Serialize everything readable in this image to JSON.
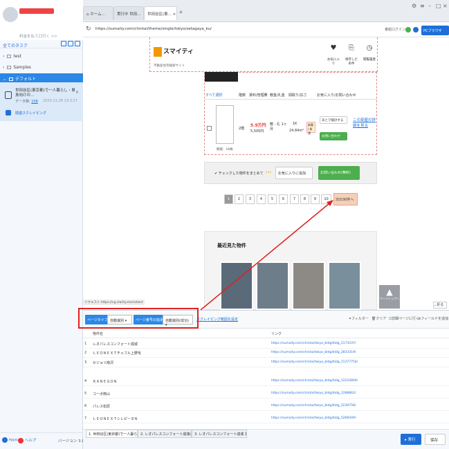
{
  "sidebar": {
    "upgrade_link": "料金を払う口行く >>",
    "tasks_title": "全てのタスク",
    "tree": [
      "test",
      "Samples"
    ],
    "default_folder": "デフォルト",
    "task": {
      "title": "世田谷区(東京都)で一人暮らし・単身向けの...",
      "meta_label": "データ数:",
      "meta_value": "108",
      "date": "2023-11-28 13:3:17",
      "sub": "関連スクレイピング"
    },
    "home": "Home",
    "help": "ヘルプ",
    "version": "バージョン 3.8.4"
  },
  "browser": {
    "tabs": [
      "ホーム...",
      "実行中 世田...",
      "世田谷区(東..."
    ],
    "url": "https://sumaity.com/chintai/theme/single/tokyo/setagaya_ku/",
    "login": "番組ログイン",
    "pc_browser": "PCブラウザ"
  },
  "site": {
    "logo": "スマイティ",
    "logo_sub": "不動産住宅検索サイト",
    "header_buttons": [
      "お気に入り",
      "保存した条件",
      "閲覧履歴"
    ],
    "filter_heads": [
      "すべて選択",
      "階数",
      "賃料/管理費",
      "敷金/礼金",
      "間取り/広さ",
      "お気に入り/お問い合わせ"
    ],
    "row": {
      "floor": "2階",
      "rent": "5.9万円",
      "mgmt": "5,500円",
      "deposit": "敷 - 礼 1ヶ月",
      "layout": "1K",
      "area": "24.84m²",
      "badge": "新築 / 新規",
      "consider": "あとで検討する",
      "inquiry": "お問い合わせ",
      "detail": "この部屋の詳細を見る",
      "plan_label": "間取：16枚"
    },
    "bulk_text": "チェックした物件をまとめて",
    "fav_add": "お気に入りに追加",
    "bulk_inquiry": "お問い合わせ(無料)",
    "pages": [
      "1",
      "2",
      "3",
      "4",
      "5",
      "6",
      "7",
      "8",
      "9",
      "10"
    ],
    "next": "次の30件へ",
    "recent_title": "最近見た物件",
    "scroll_top": "ページトップへ",
    "collapse": "折る"
  },
  "status_url": "リクエスト https://cg.clarity.ms/collect",
  "panel": {
    "page_type_label": "ページタイプ",
    "page_type_value": "自動識別",
    "page_num_label": "ページ番号の指定",
    "page_num_value": "自動識別(成功)",
    "scroll_settings": "スクレイピング範囲を設定",
    "filter": "フィルター",
    "clear": "クリア",
    "detail_pages": "詳細ページに行く",
    "add_field": "フィールドを追加",
    "columns": [
      "物件名",
      "リンク"
    ],
    "rows": [
      {
        "i": "1",
        "name": "レオパレスコンフォート成城",
        "link": "https://sumaity.com/chintai/tokyo_bldg/bldg_2174337/"
      },
      {
        "i": "2",
        "name": "ＬＥＯＮＥＸＴチャフル上野毛",
        "link": "https://sumaity.com/chintai/tokyo_bldg/bldg_2833319/"
      },
      {
        "i": "3",
        "name": "セジョリ南沢",
        "link": "https://sumaity.com/chintai/tokyo_bldg/bldg_11377754/"
      },
      {
        "i": "4",
        "name": "ＫＡＮＥＧＯＮ",
        "link": "https://sumaity.com/chintai/tokyo_bldg/bldg_12224804/"
      },
      {
        "i": "5",
        "name": "コーポ南山",
        "link": "https://sumaity.com/chintai/tokyo_bldg/bldg_1288862/"
      },
      {
        "i": "6",
        "name": "パレス松原",
        "link": "https://sumaity.com/chintai/tokyo_bldg/bldg_2239758/"
      },
      {
        "i": "7",
        "name": "ＬＥＯＮＥＸＴシレピーヌＮ",
        "link": "https://sumaity.com/chintai/tokyo_bldg/bldg_5266049/"
      }
    ]
  },
  "bottom_tabs": [
    "1. 世田谷区(東京都)で一人暮らし・...",
    "2. レオパレスコンフォート成城の...",
    "3. レオパレスコンフォート成城 1K..."
  ],
  "run": "実行",
  "save": "保存"
}
